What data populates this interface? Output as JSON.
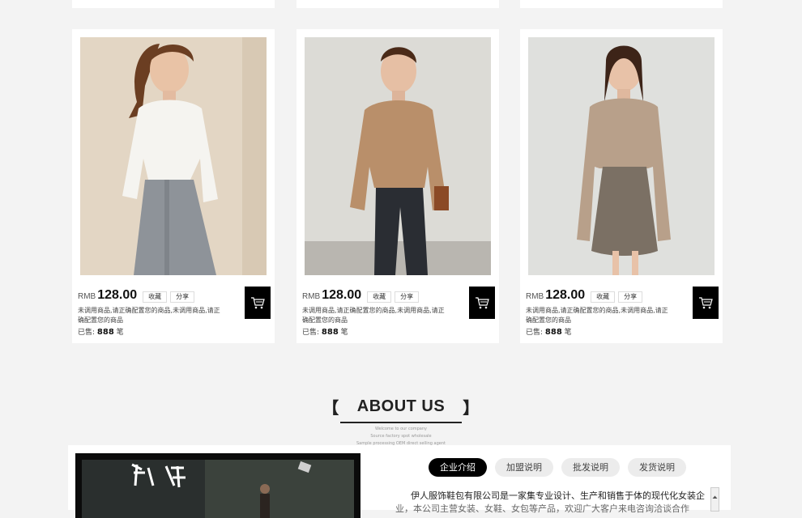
{
  "products": [
    {
      "currency": "RMB",
      "price": "128.00",
      "favorite_label": "收藏",
      "share_label": "分享",
      "description": "未调用商品,请正确配置您的商品,未调用商品,请正确配置您的商品",
      "sold_label": "已售:",
      "sold_count": "888",
      "sold_unit": "笔",
      "cart_icon": "cart-icon",
      "top_color": "#f5f4f0",
      "bottom_color": "#8e9399",
      "bg_color": "#e3d6c4"
    },
    {
      "currency": "RMB",
      "price": "128.00",
      "favorite_label": "收藏",
      "share_label": "分享",
      "description": "未调用商品,请正确配置您的商品,未调用商品,请正确配置您的商品",
      "sold_label": "已售:",
      "sold_count": "888",
      "sold_unit": "笔",
      "cart_icon": "cart-icon",
      "top_color": "#b98f6a",
      "bottom_color": "#2a2d33",
      "bg_color": "#dcdbd6"
    },
    {
      "currency": "RMB",
      "price": "128.00",
      "favorite_label": "收藏",
      "share_label": "分享",
      "description": "未调用商品,请正确配置您的商品,未调用商品,请正确配置您的商品",
      "sold_label": "已售:",
      "sold_count": "888",
      "sold_unit": "笔",
      "cart_icon": "cart-icon",
      "top_color": "#b8a08a",
      "bottom_color": "#7b7064",
      "bg_color": "#dfe0dd"
    }
  ],
  "about": {
    "bracket_left": "【",
    "title": "ABOUT US",
    "bracket_right": "】",
    "sub1": "Welcome to our company",
    "sub2": "Source factory spot wholesale",
    "sub3": "Sample processing OEM direct selling agent",
    "tabs": [
      "企业介绍",
      "加盟说明",
      "批发说明",
      "发货说明"
    ],
    "active_tab": "企业介绍",
    "intro_line1": "伊人服饰鞋包有限公司是一家集专业设计、生产和销售于体的现代化女装企",
    "intro_line2": "业，本公司主营女装、女鞋、女包等产品，欢迎广大客户来电咨询洽谈合作"
  }
}
